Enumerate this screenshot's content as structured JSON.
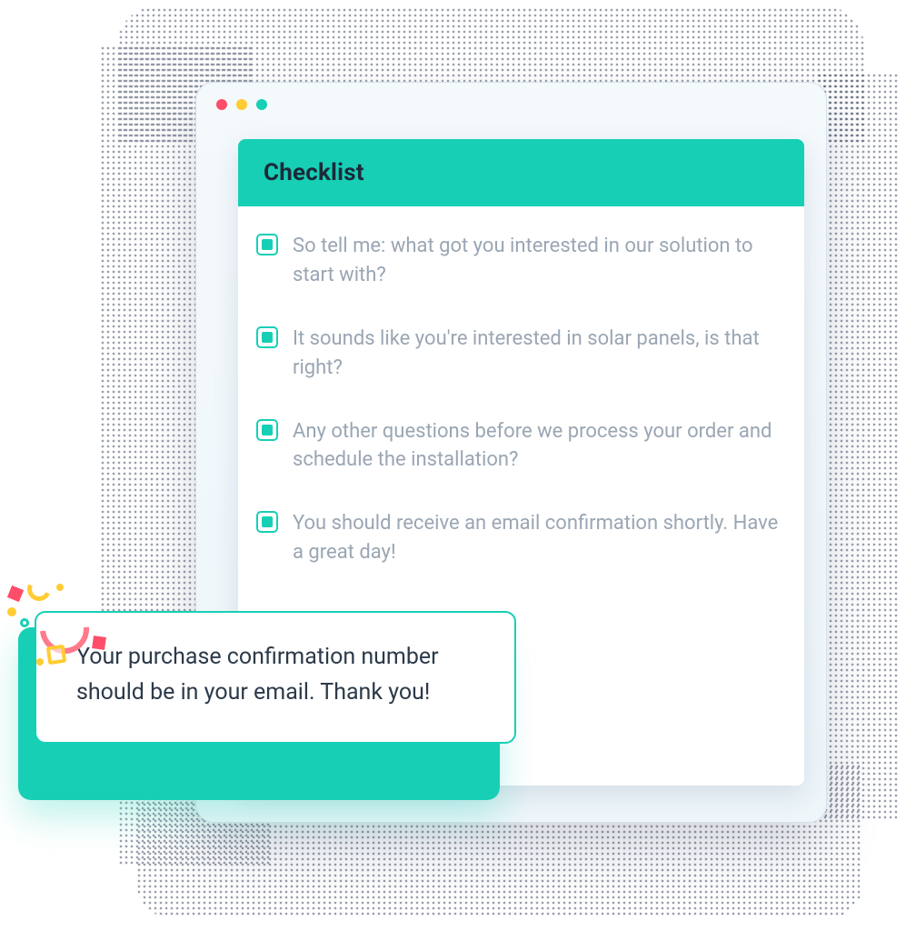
{
  "panel": {
    "title": "Checklist",
    "items": [
      "So tell me: what got you interested in our solution to start with?",
      "It sounds like you're interested in solar panels, is that right?",
      "Any other questions before we process your order and schedule the installation?",
      "You should receive an email confirmation shortly. Have a great day!"
    ]
  },
  "popup": {
    "message": "Your purchase confirmation number should be in your email. Thank you!"
  },
  "colors": {
    "accent": "#17cfb5",
    "titlebar_red": "#ff4d6a",
    "titlebar_yellow": "#ffcc33",
    "titlebar_green": "#17cfb5"
  }
}
